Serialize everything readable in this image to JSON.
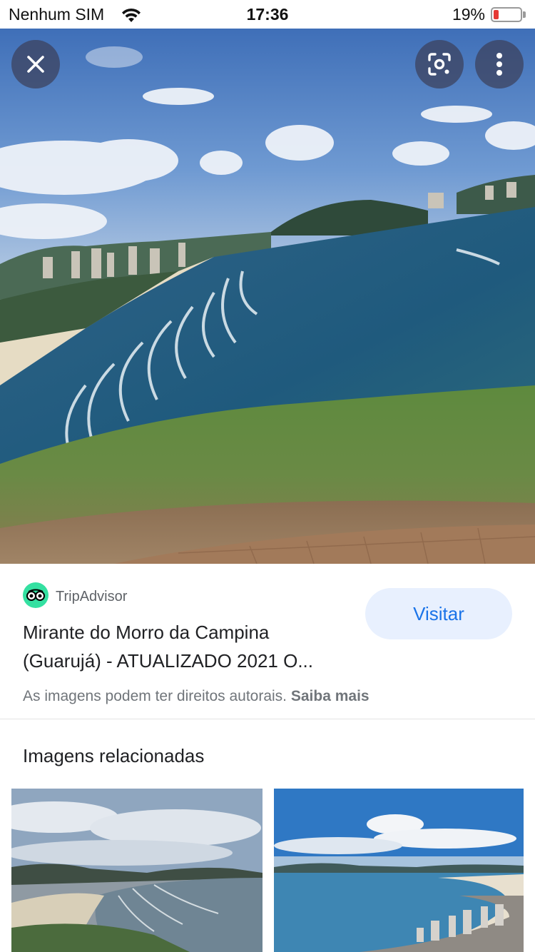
{
  "status_bar": {
    "carrier": "Nenhum SIM",
    "time": "17:36",
    "battery_percent": "19%",
    "battery_level": 0.19,
    "wifi_icon": "wifi-icon"
  },
  "viewer": {
    "close_icon": "close-icon",
    "lens_icon": "lens-icon",
    "more_icon": "more-vertical-icon"
  },
  "result": {
    "source": "TripAdvisor",
    "source_icon": "tripadvisor-owl-icon",
    "title_line1": "Mirante do Morro da Campina",
    "title_line2": "(Guarujá) - ATUALIZADO 2021 O...",
    "visit_label": "Visitar",
    "copyright_text": "As imagens podem ter direitos autorais.",
    "learn_more": "Saiba mais"
  },
  "related": {
    "heading": "Imagens relacionadas"
  },
  "colors": {
    "accent": "#1a73e8",
    "accent_bg": "#e8f0fe",
    "tripadvisor": "#34e0a1",
    "battery_low": "#e53935"
  }
}
